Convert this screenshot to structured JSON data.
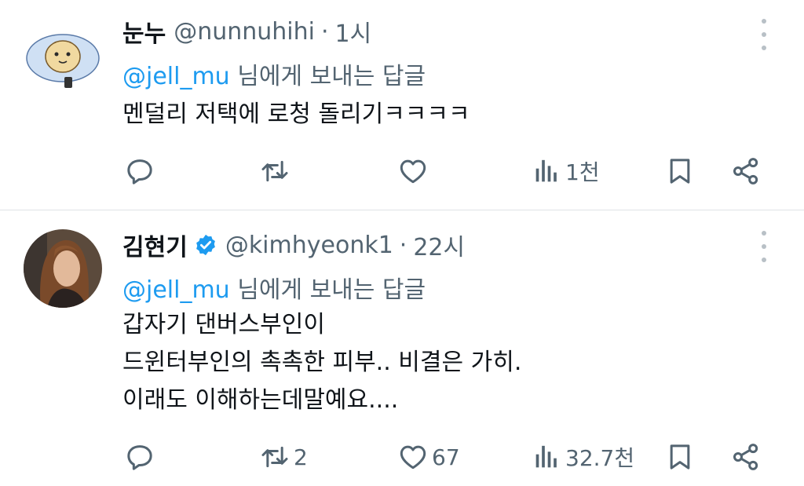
{
  "tweets": [
    {
      "name": "눈누",
      "verified": false,
      "handle": "@nunnuhihi",
      "separator": "·",
      "time": "1시",
      "reply_to_mention": "@jell_mu",
      "reply_to_suffix": " 님에게 보내는 답글",
      "text": "멘덜리 저택에 로청 돌리기ㅋㅋㅋㅋ",
      "replies": "",
      "retweets": "",
      "likes": "",
      "views": "1천"
    },
    {
      "name": "김현기",
      "verified": true,
      "handle": "@kimhyeonk1",
      "separator": "·",
      "time": "22시",
      "reply_to_mention": "@jell_mu",
      "reply_to_suffix": " 님에게 보내는 답글",
      "text": "갑자기 댄버스부인이\n드윈터부인의 촉촉한 피부.. 비결은 가히.\n이래도 이해하는데말예요....",
      "replies": "",
      "retweets": "2",
      "likes": "67",
      "views": "32.7천"
    }
  ],
  "colors": {
    "text_primary": "#0f1419",
    "text_secondary": "#536471",
    "accent": "#1d9bf0",
    "divider": "#dfe3e6"
  },
  "icons": [
    "reply-icon",
    "retweet-icon",
    "like-icon",
    "views-icon",
    "bookmark-icon",
    "share-icon",
    "more-icon",
    "verified-badge-icon"
  ]
}
